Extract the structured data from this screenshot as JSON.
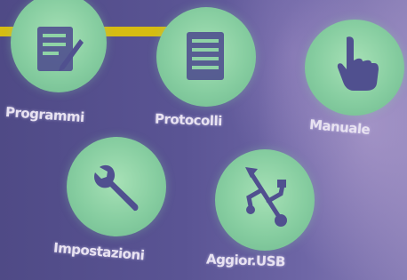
{
  "menu": {
    "items": [
      {
        "label": "Programmi",
        "icon": "document-pencil-icon"
      },
      {
        "label": "Protocolli",
        "icon": "document-list-icon"
      },
      {
        "label": "Manuale",
        "icon": "hand-pointer-icon"
      },
      {
        "label": "Impostazioni",
        "icon": "wrench-icon"
      },
      {
        "label": "Aggior.USB",
        "icon": "usb-icon"
      }
    ]
  },
  "colors": {
    "icon_bg": "#8fd3a6",
    "icon_fg": "#4f4a86",
    "accent_stripe": "#d7bc12",
    "label": "#e8e2f1"
  }
}
